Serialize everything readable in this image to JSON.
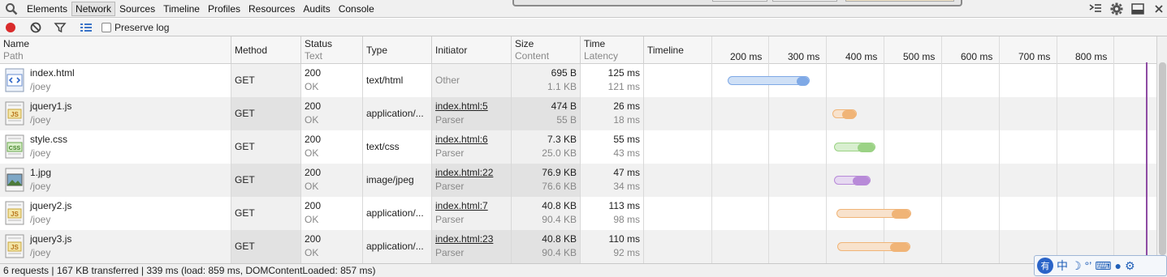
{
  "tabs": [
    "Elements",
    "Network",
    "Sources",
    "Timeline",
    "Profiles",
    "Resources",
    "Audits",
    "Console"
  ],
  "active_tab": "Network",
  "toolbar": {
    "preserve_log": "Preserve log"
  },
  "columns": {
    "name": "Name",
    "path": "Path",
    "method": "Method",
    "status": "Status",
    "text": "Text",
    "type": "Type",
    "initiator": "Initiator",
    "size": "Size",
    "content": "Content",
    "time": "Time",
    "latency": "Latency",
    "timeline": "Timeline"
  },
  "ticks": [
    "200 ms",
    "300 ms",
    "400 ms",
    "500 ms",
    "600 ms",
    "700 ms",
    "800 ms"
  ],
  "rows": [
    {
      "name": "index.html",
      "path": "/joey",
      "method": "GET",
      "status": "200",
      "status_text": "OK",
      "type": "text/html",
      "initiator": "Other",
      "initiator_sub": "",
      "size": "695 B",
      "content": "1.1 KB",
      "time": "125 ms",
      "latency": "121 ms",
      "icon": "html-file-icon"
    },
    {
      "name": "jquery1.js",
      "path": "/joey",
      "method": "GET",
      "status": "200",
      "status_text": "OK",
      "type": "application/...",
      "initiator": "index.html:5",
      "initiator_sub": "Parser",
      "size": "474 B",
      "content": "55 B",
      "time": "26 ms",
      "latency": "18 ms",
      "icon": "js-file-icon"
    },
    {
      "name": "style.css",
      "path": "/joey",
      "method": "GET",
      "status": "200",
      "status_text": "OK",
      "type": "text/css",
      "initiator": "index.html:6",
      "initiator_sub": "Parser",
      "size": "7.3 KB",
      "content": "25.0 KB",
      "time": "55 ms",
      "latency": "43 ms",
      "icon": "css-file-icon"
    },
    {
      "name": "1.jpg",
      "path": "/joey",
      "method": "GET",
      "status": "200",
      "status_text": "OK",
      "type": "image/jpeg",
      "initiator": "index.html:22",
      "initiator_sub": "Parser",
      "size": "76.9 KB",
      "content": "76.6 KB",
      "time": "47 ms",
      "latency": "34 ms",
      "icon": "image-file-icon"
    },
    {
      "name": "jquery2.js",
      "path": "/joey",
      "method": "GET",
      "status": "200",
      "status_text": "OK",
      "type": "application/...",
      "initiator": "index.html:7",
      "initiator_sub": "Parser",
      "size": "40.8 KB",
      "content": "90.4 KB",
      "time": "113 ms",
      "latency": "98 ms",
      "icon": "js-file-icon"
    },
    {
      "name": "jquery3.js",
      "path": "/joey",
      "method": "GET",
      "status": "200",
      "status_text": "OK",
      "type": "application/...",
      "initiator": "index.html:23",
      "initiator_sub": "Parser",
      "size": "40.8 KB",
      "content": "90.4 KB",
      "time": "110 ms",
      "latency": "92 ms",
      "icon": "js-file-icon"
    }
  ],
  "bar_colors": {
    "html": [
      "#cfe0f6",
      "#7fa9e6"
    ],
    "js": [
      "#f8e2cc",
      "#f0b477"
    ],
    "css": [
      "#d8efcf",
      "#9bd285"
    ],
    "img": [
      "#e6d9f1",
      "#b88ad8"
    ]
  },
  "status_text": "6 requests | 167 KB transferred | 339 ms (load: 859 ms, DOMContentLoaded: 857 ms)",
  "ime": {
    "logo": "有",
    "mode": "中"
  }
}
